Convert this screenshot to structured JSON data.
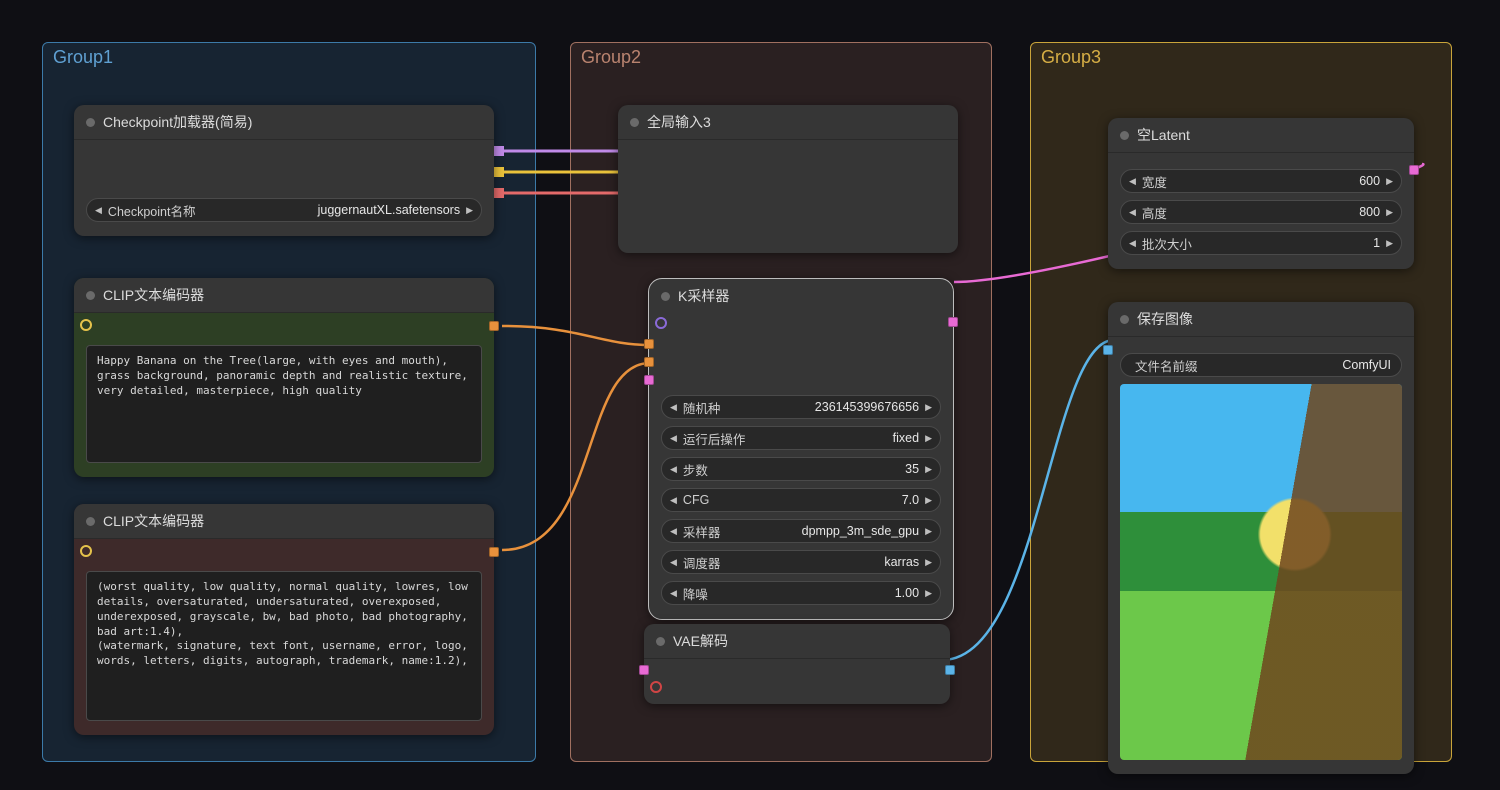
{
  "groups": {
    "g1": {
      "title": "Group1"
    },
    "g2": {
      "title": "Group2"
    },
    "g3": {
      "title": "Group3"
    }
  },
  "checkpoint": {
    "title": "Checkpoint加载器(简易)",
    "param_label": "Checkpoint名称",
    "param_value": "juggernautXL.safetensors"
  },
  "clip_pos": {
    "title": "CLIP文本编码器",
    "text": "Happy Banana on the Tree(large, with eyes and mouth), grass background, panoramic depth and realistic texture, very detailed, masterpiece, high quality"
  },
  "clip_neg": {
    "title": "CLIP文本编码器",
    "text": "(worst quality, low quality, normal quality, lowres, low details, oversaturated, undersaturated, overexposed, underexposed, grayscale, bw, bad photo, bad photography, bad art:1.4),\n(watermark, signature, text font, username, error, logo, words, letters, digits, autograph, trademark, name:1.2),"
  },
  "reroute": {
    "title": "全局输入3"
  },
  "ksampler": {
    "title": "K采样器",
    "rows": [
      {
        "label": "随机种",
        "value": "236145399676656"
      },
      {
        "label": "运行后操作",
        "value": "fixed"
      },
      {
        "label": "步数",
        "value": "35"
      },
      {
        "label": "CFG",
        "value": "7.0"
      },
      {
        "label": "采样器",
        "value": "dpmpp_3m_sde_gpu"
      },
      {
        "label": "调度器",
        "value": "karras"
      },
      {
        "label": "降噪",
        "value": "1.00"
      }
    ]
  },
  "vae": {
    "title": "VAE解码"
  },
  "latent": {
    "title": "空Latent",
    "rows": [
      {
        "label": "宽度",
        "value": "600"
      },
      {
        "label": "高度",
        "value": "800"
      },
      {
        "label": "批次大小",
        "value": "1"
      }
    ]
  },
  "save": {
    "title": "保存图像",
    "prefix_label": "文件名前缀",
    "prefix_value": "ComfyUI"
  },
  "colors": {
    "violet": "#c08ae8",
    "yellow": "#eac23b",
    "salmon": "#e46a6a",
    "orange": "#e8913c",
    "pink": "#e86ad4",
    "cyan": "#5bb4e8"
  }
}
